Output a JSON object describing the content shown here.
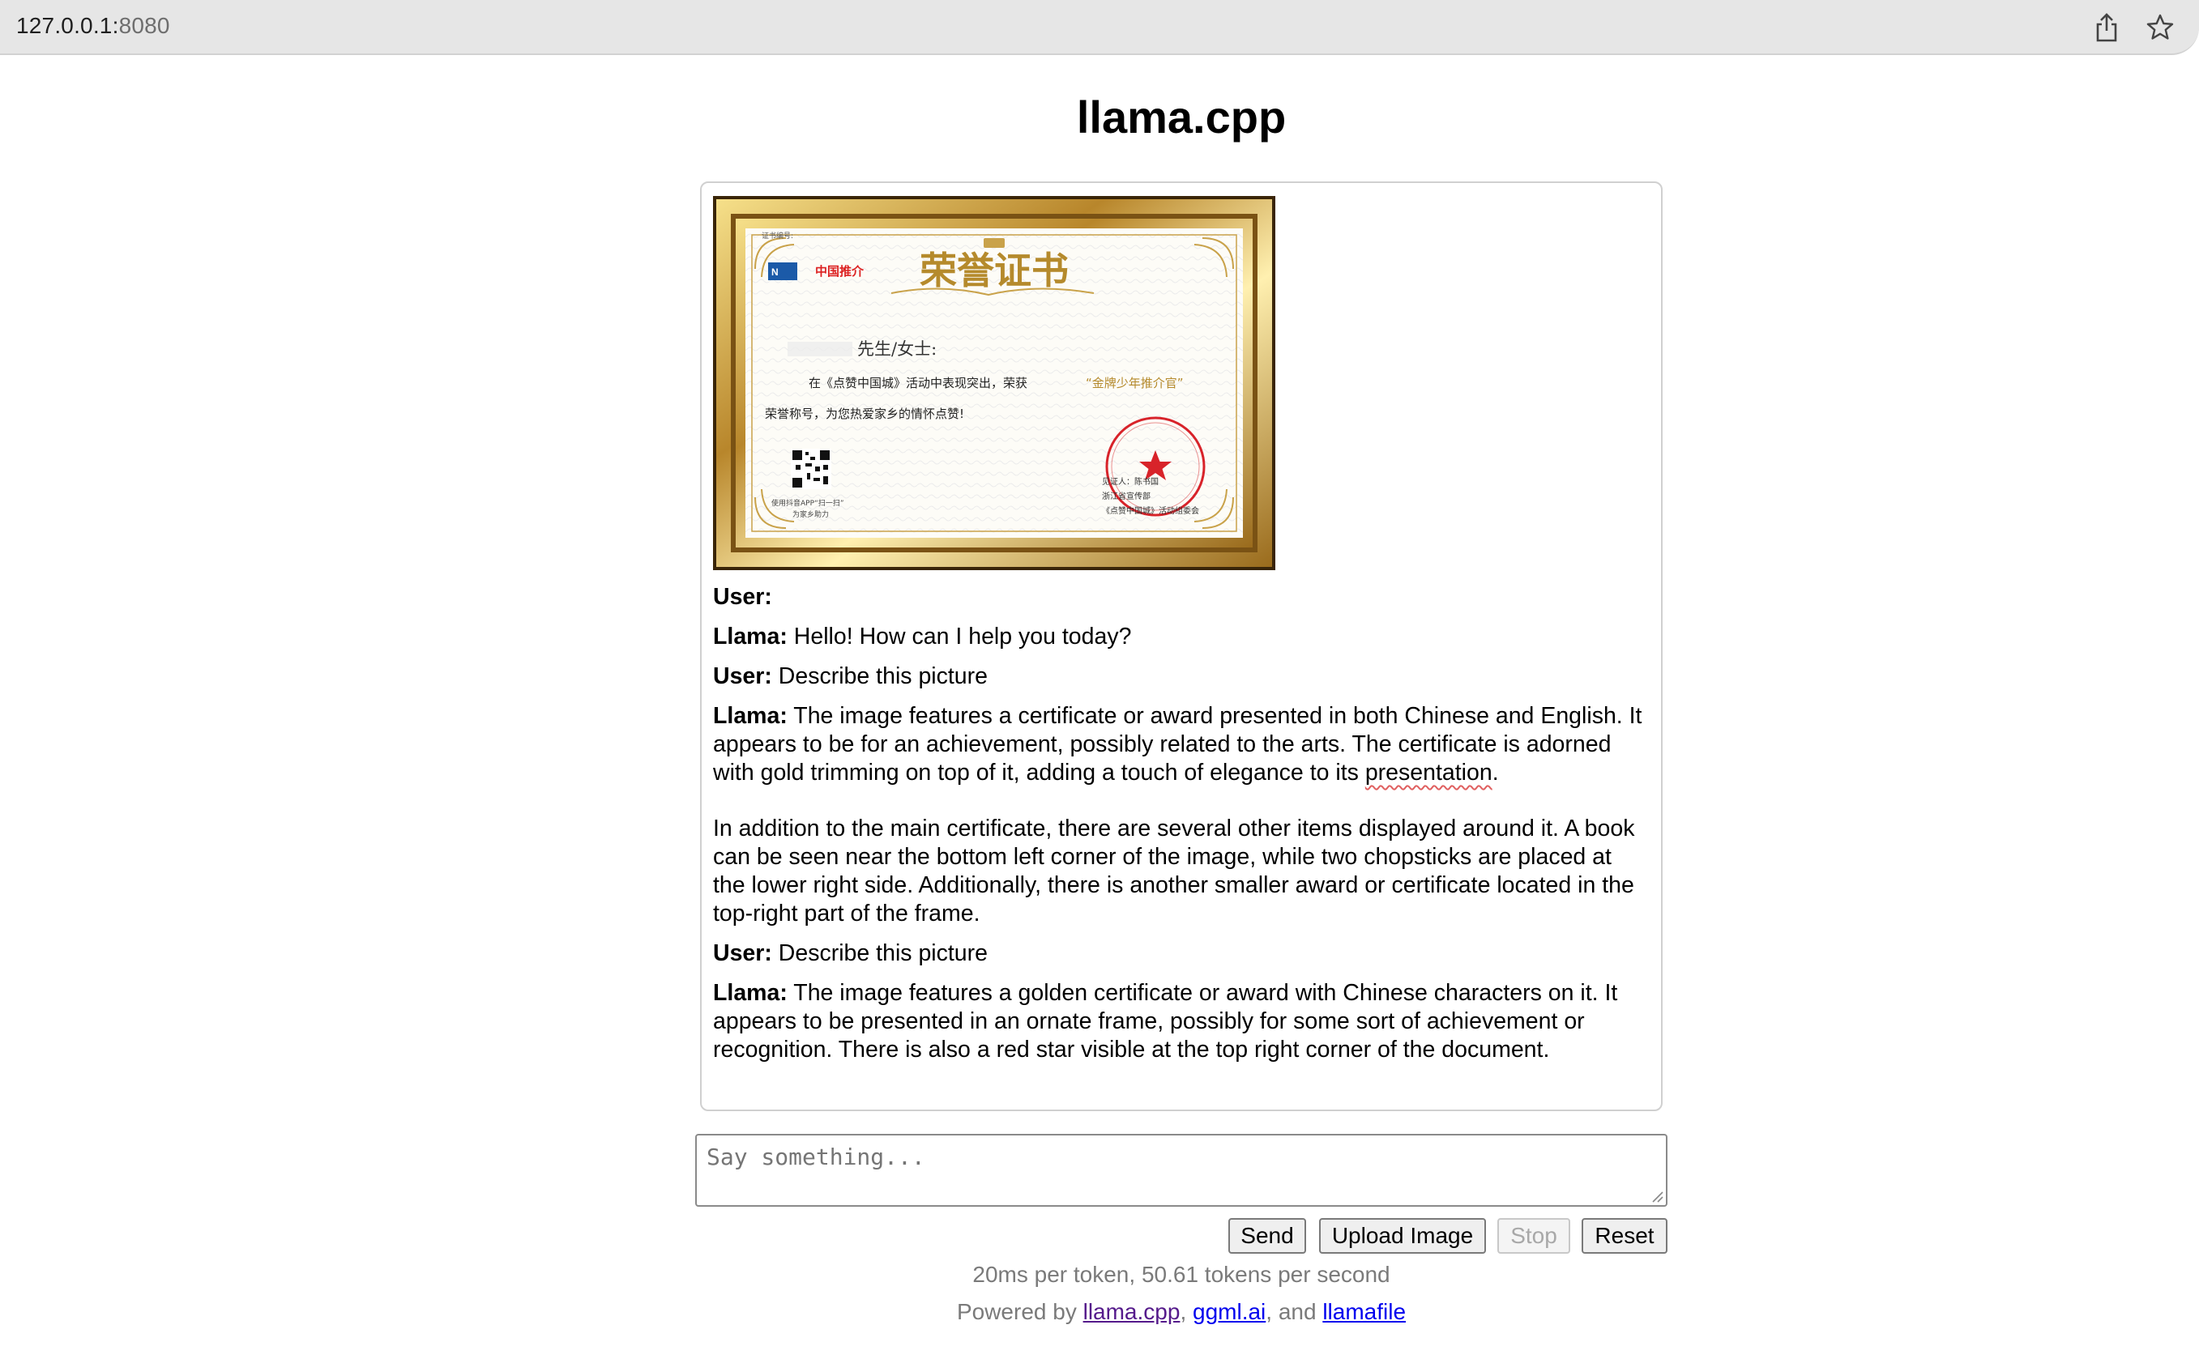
{
  "browser": {
    "url_host": "127.0.0.1:",
    "url_port": "8080",
    "share_icon": "share-icon",
    "bookmark_icon": "star-icon"
  },
  "page": {
    "title": "llama.cpp"
  },
  "certificate_image": {
    "cert_number_label": "证书编号:",
    "main_title": "荣誉证书",
    "logo_brand": "中国推介",
    "salutation": "先生/女士:",
    "body_line1_a": "在《点赞中国城》活动中表现突出，荣获",
    "body_line1_b": "“金牌少年推介官”",
    "body_line2": "荣誉称号，为您热爱家乡的情怀点赞!",
    "qr_caption1": "使用抖音APP“扫一扫”",
    "qr_caption2": "为家乡助力",
    "issuer1": "见证人：陈书国",
    "issuer2": "浙江省宣传部",
    "issuer3": "《点赞中国城》活动组委会"
  },
  "messages": [
    {
      "speaker": "User:",
      "paras": [
        ""
      ]
    },
    {
      "speaker": "Llama:",
      "paras": [
        "Hello! How can I help you today?"
      ]
    },
    {
      "speaker": "User:",
      "paras": [
        "Describe this picture"
      ]
    },
    {
      "speaker": "Llama:",
      "paras": [
        "The image features a certificate or award presented in both Chinese and English. It appears to be for an achievement, possibly related to the arts. The certificate is adorned with gold trimming on top of it, adding a touch of elegance to its presentation.",
        "In addition to the main certificate, there are several other items displayed around it. A book can be seen near the bottom left corner of the image, while two chopsticks are placed at the lower right side. Additionally, there is another smaller award or certificate located in the top-right part of the frame."
      ]
    },
    {
      "speaker": "User:",
      "paras": [
        "Describe this picture"
      ]
    },
    {
      "speaker": "Llama:",
      "paras": [
        "The image features a golden certificate or award with Chinese characters on it. It appears to be presented in an ornate frame, possibly for some sort of achievement or recognition. There is also a red star visible at the top right corner of the document."
      ]
    }
  ],
  "input": {
    "placeholder": "Say something...",
    "value": ""
  },
  "buttons": {
    "send": "Send",
    "upload": "Upload Image",
    "stop": "Stop",
    "reset": "Reset"
  },
  "stats": "20ms per token, 50.61 tokens per second",
  "footer": {
    "prefix": "Powered by ",
    "link1": "llama.cpp",
    "sep1": ", ",
    "link2": "ggml.ai",
    "sep2": ", and ",
    "link3": "llamafile"
  },
  "colors": {
    "gold": "#c9a24a",
    "seal_red": "#d8232a",
    "link": "#0000ee",
    "visited": "#551a8b"
  }
}
